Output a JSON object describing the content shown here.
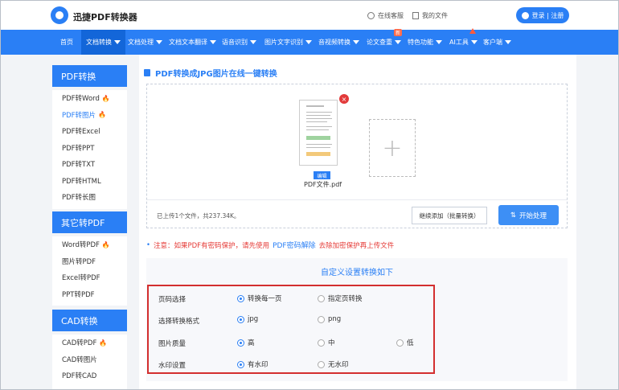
{
  "header": {
    "app_name": "迅捷PDF转换器",
    "service_link": "在线客服",
    "my_files_link": "我的文件",
    "login_button": "登录 | 注册"
  },
  "nav": {
    "items": [
      {
        "label": "首页"
      },
      {
        "label": "文档转换"
      },
      {
        "label": "文档处理"
      },
      {
        "label": "文档文本翻译"
      },
      {
        "label": "语音识别"
      },
      {
        "label": "图片文字识别"
      },
      {
        "label": "音视频转换"
      },
      {
        "label": "论文查重"
      },
      {
        "label": "特色功能"
      },
      {
        "label": "AI工具"
      },
      {
        "label": "客户端"
      }
    ],
    "badge_new": "新"
  },
  "sidebar": {
    "sections": [
      {
        "title": "PDF转换",
        "items": [
          "PDF转Word",
          "PDF转图片",
          "PDF转Excel",
          "PDF转PPT",
          "PDF转TXT",
          "PDF转HTML",
          "PDF转长图"
        ]
      },
      {
        "title": "其它转PDF",
        "items": [
          "Word转PDF",
          "图片转PDF",
          "Excel转PDF",
          "PPT转PDF"
        ]
      },
      {
        "title": "CAD转换",
        "items": [
          "CAD转PDF",
          "CAD转图片",
          "PDF转CAD"
        ]
      }
    ]
  },
  "main": {
    "title": "PDF转换成JPG图片在线一键转换",
    "file_name": "PDF文件.pdf",
    "edit_tag": "编辑",
    "upload_info": "已上传1个文件，共237.34K。",
    "continue_button": "继续添加（批量转换）",
    "start_button": "开始处理",
    "notice_prefix": "注意：如果PDF有密码保护，请先使用",
    "notice_link": "PDF密码解除",
    "notice_suffix": "去除加密保护再上传文件",
    "settings_title": "自定义设置转换如下",
    "rows": [
      {
        "label": "页码选择",
        "options": [
          "转换每一页",
          "指定页转换"
        ]
      },
      {
        "label": "选择转换格式",
        "options": [
          "jpg",
          "png"
        ]
      },
      {
        "label": "图片质量",
        "options": [
          "高",
          "中",
          "低"
        ]
      },
      {
        "label": "水印设置",
        "options": [
          "有水印",
          "无水印"
        ]
      }
    ]
  }
}
